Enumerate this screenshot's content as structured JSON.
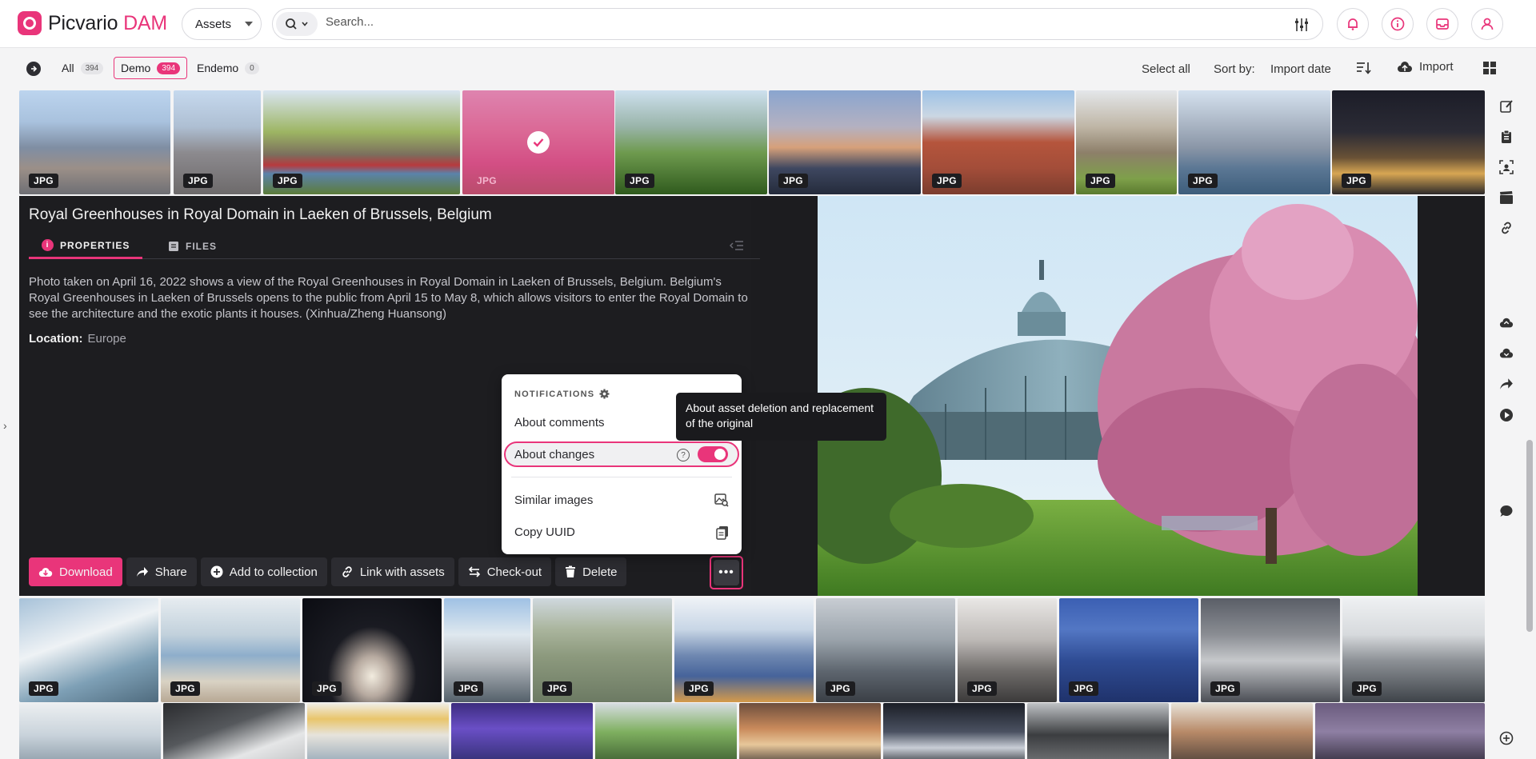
{
  "app": {
    "name": "Picvario",
    "name_accent": "DAM"
  },
  "topbar": {
    "scope": "Assets",
    "search_placeholder": "Search..."
  },
  "filters": {
    "chips": [
      {
        "label": "All",
        "count": "394"
      },
      {
        "label": "Demo",
        "count": "394"
      },
      {
        "label": "Endemo",
        "count": "0"
      }
    ],
    "select_all": "Select all",
    "sort_label": "Sort by:",
    "sort_value": "Import date",
    "import": "Import"
  },
  "badge": "JPG",
  "strip_top_count": 10,
  "asset": {
    "title": "Royal Greenhouses in Royal Domain in Laeken of Brussels, Belgium",
    "tab_properties": "PROPERTIES",
    "tab_files": "FILES",
    "description": "Photo taken on April 16, 2022 shows a view of the Royal Greenhouses in Royal Domain in Laeken of Brussels, Belgium. Belgium's Royal Greenhouses in Laeken of Brussels opens to the public from April 15 to May 8, which allows visitors to enter the Royal Domain to see the architecture and the exotic plants it houses. (Xinhua/Zheng Huansong)",
    "location_label": "Location:",
    "location_value": "Europe"
  },
  "actions": {
    "download": "Download",
    "share": "Share",
    "add_to_collection": "Add to collection",
    "link_with_assets": "Link with assets",
    "check_out": "Check-out",
    "delete": "Delete"
  },
  "menu": {
    "header": "NOTIFICATIONS",
    "about_comments": "About comments",
    "about_changes": "About changes",
    "about_changes_enabled": true,
    "similar_images": "Similar images",
    "copy_uuid": "Copy UUID"
  },
  "tooltip": "About asset deletion and replacement of the original",
  "colors": {
    "accent": "#e9357a",
    "dark_panel": "#1d1d20"
  }
}
